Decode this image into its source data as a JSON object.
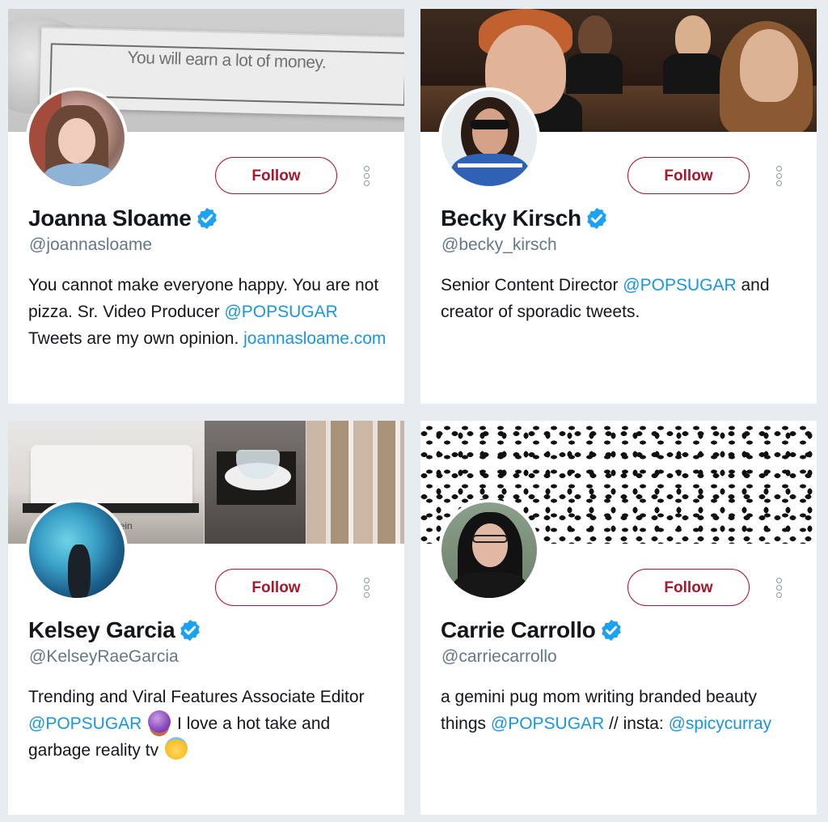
{
  "cards": [
    {
      "banner_text": "You will earn a lot of money.",
      "name": "Joanna Sloame",
      "handle": "@joannasloame",
      "follow_label": "Follow",
      "bio_parts": [
        "You cannot make everyone happy. You are not pizza. Sr. Video Producer ",
        "@POPSUGAR",
        " Tweets are my own opinion. ",
        "joannasloame.com"
      ]
    },
    {
      "name": "Becky Kirsch",
      "handle": "@becky_kirsch",
      "follow_label": "Follow",
      "bio_parts": [
        "Senior Content Director ",
        "@POPSUGAR",
        " and creator of sporadic tweets."
      ]
    },
    {
      "banner_text": "lein",
      "name": "Kelsey Garcia",
      "handle": "@KelseyRaeGarcia",
      "follow_label": "Follow",
      "bio_parts": [
        "Trending and Viral Features Associate Editor ",
        "@POPSUGAR",
        " I love a hot take and garbage reality tv"
      ],
      "emojis": [
        "crystal-ball-emoji",
        "smiling-face-with-halo-emoji"
      ]
    },
    {
      "name": "Carrie Carrollo",
      "handle": "@carriecarrollo",
      "follow_label": "Follow",
      "bio_parts": [
        "a gemini pug mom writing branded beauty things ",
        "@POPSUGAR",
        " // insta: ",
        "@spicycurray"
      ]
    }
  ],
  "colors": {
    "background": "#e6ecf0",
    "follow_accent": "#a8182c",
    "link": "#1b95e0",
    "verified": "#1da1f2",
    "handle": "#657786"
  },
  "icons": [
    "verified-badge-icon",
    "more-options-icon"
  ]
}
